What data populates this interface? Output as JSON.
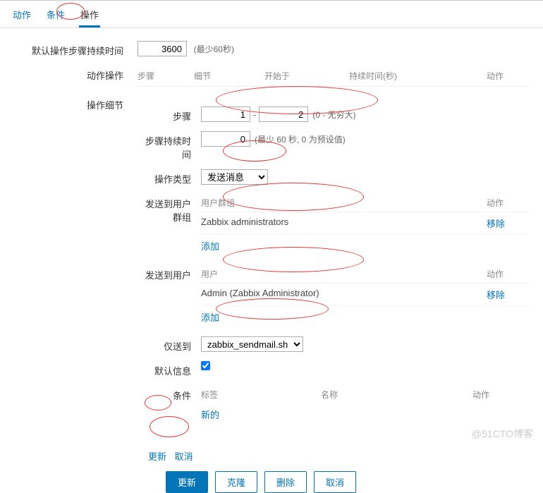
{
  "tabs": {
    "action": "动作",
    "condition": "条件",
    "operation": "操作"
  },
  "defaultDuration": {
    "label": "默认操作步骤持续时间",
    "value": "3600",
    "hint": "(最少60秒)"
  },
  "actionOp": {
    "label": "动作操作",
    "headers": {
      "step": "步骤",
      "detail": "细节",
      "start": "开始于",
      "duration": "持续时间(秒)",
      "action": "动作"
    }
  },
  "detailsLabel": "操作细节",
  "step": {
    "label": "步骤",
    "from": "1",
    "to": "2",
    "hint": "(0 - 无穷大)"
  },
  "stepDuration": {
    "label": "步骤持续时间",
    "value": "0",
    "hint": "(最少 60 秒, 0 为预设值)"
  },
  "opType": {
    "label": "操作类型",
    "selected": "发送消息"
  },
  "sendGroups": {
    "label": "发送到用户群组",
    "header_left": "用户群组",
    "header_right": "动作",
    "row": "Zabbix administrators",
    "remove": "移除",
    "add": "添加"
  },
  "sendUsers": {
    "label": "发送到用户",
    "header_left": "用户",
    "header_right": "动作",
    "row": "Admin (Zabbix Administrator)",
    "remove": "移除",
    "add": "添加"
  },
  "onlySend": {
    "label": "仅送到",
    "selected": "zabbix_sendmail.sh"
  },
  "defaultMsg": {
    "label": "默认信息"
  },
  "conditions": {
    "label": "条件",
    "header_tag": "标签",
    "header_name": "名称",
    "header_action": "动作",
    "new": "新的"
  },
  "updateCancel": {
    "update": "更新",
    "cancel": "取消"
  },
  "buttons": {
    "update": "更新",
    "clone": "克隆",
    "delete": "删除",
    "cancel": "取消"
  },
  "watermark": "@51CTO博客"
}
